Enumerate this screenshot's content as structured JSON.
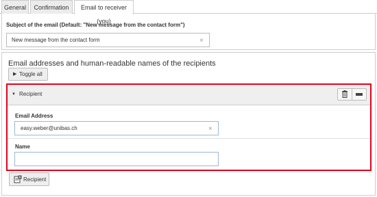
{
  "tabs": [
    {
      "label": "General"
    },
    {
      "label": "Confirmation"
    },
    {
      "label": "Email to receiver (you)"
    }
  ],
  "subject": {
    "label": "Subject of the email (Default: \"New message from the contact form\")",
    "value": "New message from the contact form"
  },
  "recipients": {
    "title": "Email addresses and human-readable names of the recipients",
    "toggle_all_label": "Toggle all",
    "item": {
      "header_label": "Recipient",
      "email_label": "Email Address",
      "email_value": "easy.weber@unibas.ch",
      "name_label": "Name",
      "name_value": ""
    },
    "add_label": "Recipient"
  },
  "colors": {
    "highlight_border": "#e2001a",
    "focused_input_border": "#9ab7d6"
  }
}
